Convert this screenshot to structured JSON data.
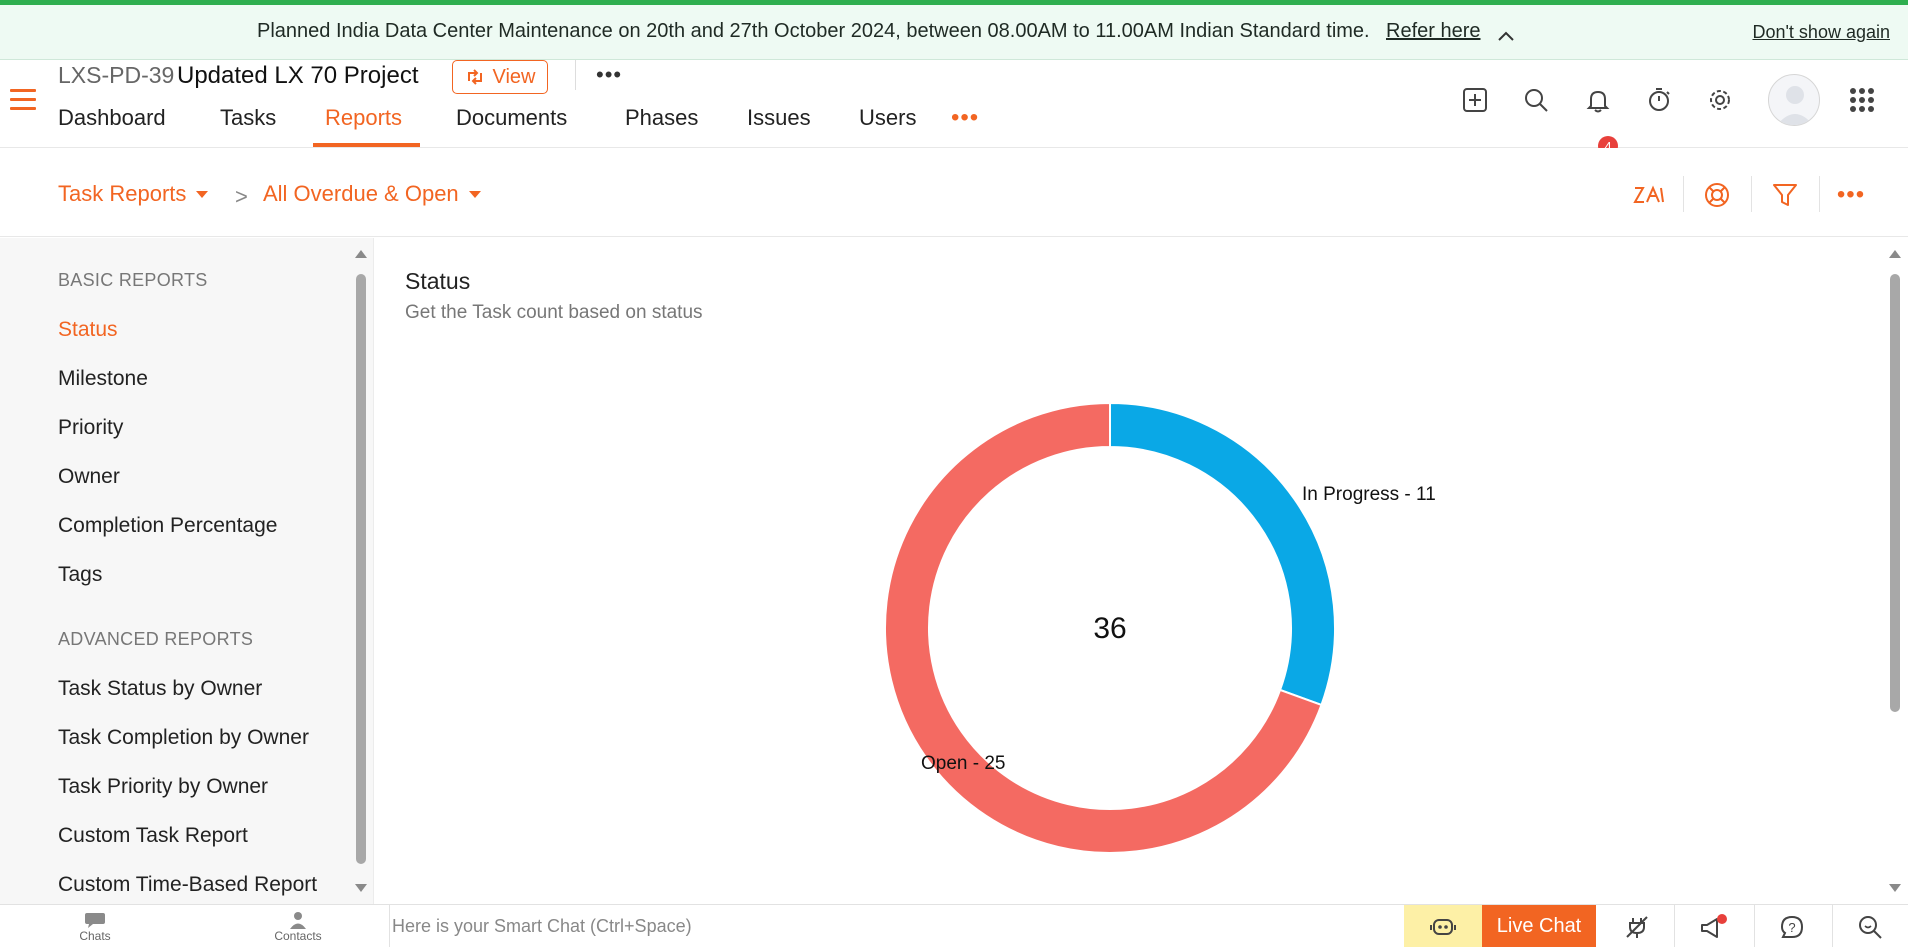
{
  "banner": {
    "message": "Planned India Data Center Maintenance on 20th and 27th October 2024, between 08.00AM to 11.00AM Indian Standard time.",
    "link": "Refer here",
    "dismiss": "Don't show again"
  },
  "header": {
    "project_code": "LXS-PD-39",
    "project_name": "Updated LX 70 Project",
    "view_label": "View",
    "more_label": "•••",
    "nav_more_label": "•••",
    "tabs": [
      {
        "label": "Dashboard"
      },
      {
        "label": "Tasks"
      },
      {
        "label": "Reports",
        "active": true
      },
      {
        "label": "Documents"
      },
      {
        "label": "Phases"
      },
      {
        "label": "Issues"
      },
      {
        "label": "Users"
      }
    ],
    "notification_count": "4",
    "icons": [
      "plus-square-icon",
      "search-icon",
      "bell-icon",
      "timer-icon",
      "gear-icon",
      "avatar",
      "app-grid-icon"
    ]
  },
  "breadcrumb": {
    "report_type": "Task Reports",
    "separator": ">",
    "view": "All Overdue & Open",
    "tools": [
      "zia-icon",
      "lifebuoy-icon",
      "filter-icon",
      "more-icon"
    ],
    "tool_more_label": "•••"
  },
  "sidebar": {
    "basic_heading": "BASIC REPORTS",
    "basic_items": [
      {
        "label": "Status",
        "active": true
      },
      {
        "label": "Milestone"
      },
      {
        "label": "Priority"
      },
      {
        "label": "Owner"
      },
      {
        "label": "Completion Percentage"
      },
      {
        "label": "Tags"
      }
    ],
    "advanced_heading": "ADVANCED REPORTS",
    "advanced_items": [
      {
        "label": "Task Status by Owner"
      },
      {
        "label": "Task Completion by Owner"
      },
      {
        "label": "Task Priority by Owner"
      },
      {
        "label": "Custom Task Report"
      },
      {
        "label": "Custom Time-Based Report"
      }
    ]
  },
  "report": {
    "title": "Status",
    "subtitle": "Get the Task count based on status"
  },
  "chart_data": {
    "type": "pie",
    "donut": true,
    "center_label": "36",
    "slices": [
      {
        "label": "In Progress",
        "value": 11,
        "color": "#0aa8e6",
        "display": "In Progress - 11"
      },
      {
        "label": "Open",
        "value": 25,
        "color": "#f46a62",
        "display": "Open - 25"
      }
    ]
  },
  "bottombar": {
    "chats_label": "Chats",
    "contacts_label": "Contacts",
    "smart_chat_placeholder": "Here is your Smart Chat (Ctrl+Space)",
    "live_chat_label": "Live Chat",
    "icons": [
      "bot-icon",
      "plug-icon",
      "megaphone-icon",
      "help-icon",
      "search-chat-icon"
    ]
  },
  "colors": {
    "accent": "#f26522",
    "banner_bg": "#eefaf3",
    "banner_border": "#2fae4f",
    "badge": "#e8403b"
  }
}
